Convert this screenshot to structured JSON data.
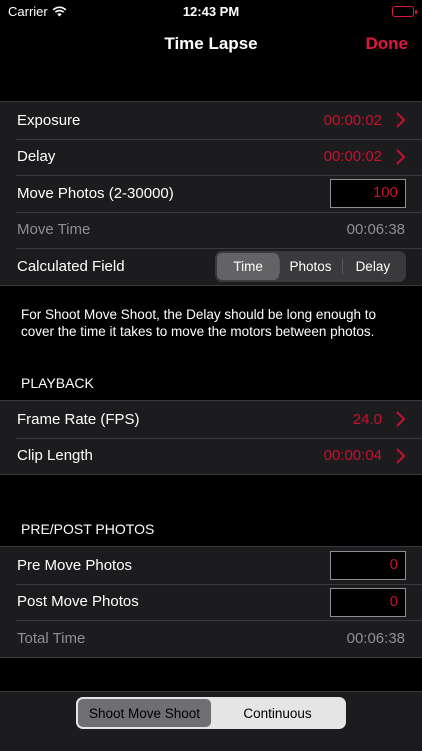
{
  "status_bar": {
    "carrier": "Carrier",
    "time": "12:43 PM"
  },
  "nav": {
    "title": "Time Lapse",
    "done_label": "Done"
  },
  "settings": {
    "exposure": {
      "label": "Exposure",
      "value": "00:00:02"
    },
    "delay": {
      "label": "Delay",
      "value": "00:00:02"
    },
    "move_photos": {
      "label": "Move Photos (2-30000)",
      "value": "100"
    },
    "move_time": {
      "label": "Move Time",
      "value": "00:06:38"
    },
    "calculated_field": {
      "label": "Calculated Field",
      "options": [
        "Time",
        "Photos",
        "Delay"
      ],
      "selected": "Time"
    }
  },
  "note": "For Shoot Move Shoot, the Delay should be long enough to cover the time it takes to move the motors between photos.",
  "playback": {
    "header": "PLAYBACK",
    "frame_rate": {
      "label": "Frame Rate (FPS)",
      "value": "24.0"
    },
    "clip_length": {
      "label": "Clip Length",
      "value": "00:00:04"
    }
  },
  "pre_post": {
    "header": "PRE/POST PHOTOS",
    "pre_move": {
      "label": "Pre Move Photos",
      "value": "0"
    },
    "post_move": {
      "label": "Post Move Photos",
      "value": "0"
    },
    "total_time": {
      "label": "Total Time",
      "value": "00:06:38"
    }
  },
  "mode": {
    "options": [
      "Shoot Move Shoot",
      "Continuous"
    ],
    "selected": "Shoot Move Shoot"
  },
  "colors": {
    "accent": "#e0163f",
    "value_red": "#c4122f",
    "cell_bg": "#1c1c1e",
    "background": "#000000"
  }
}
